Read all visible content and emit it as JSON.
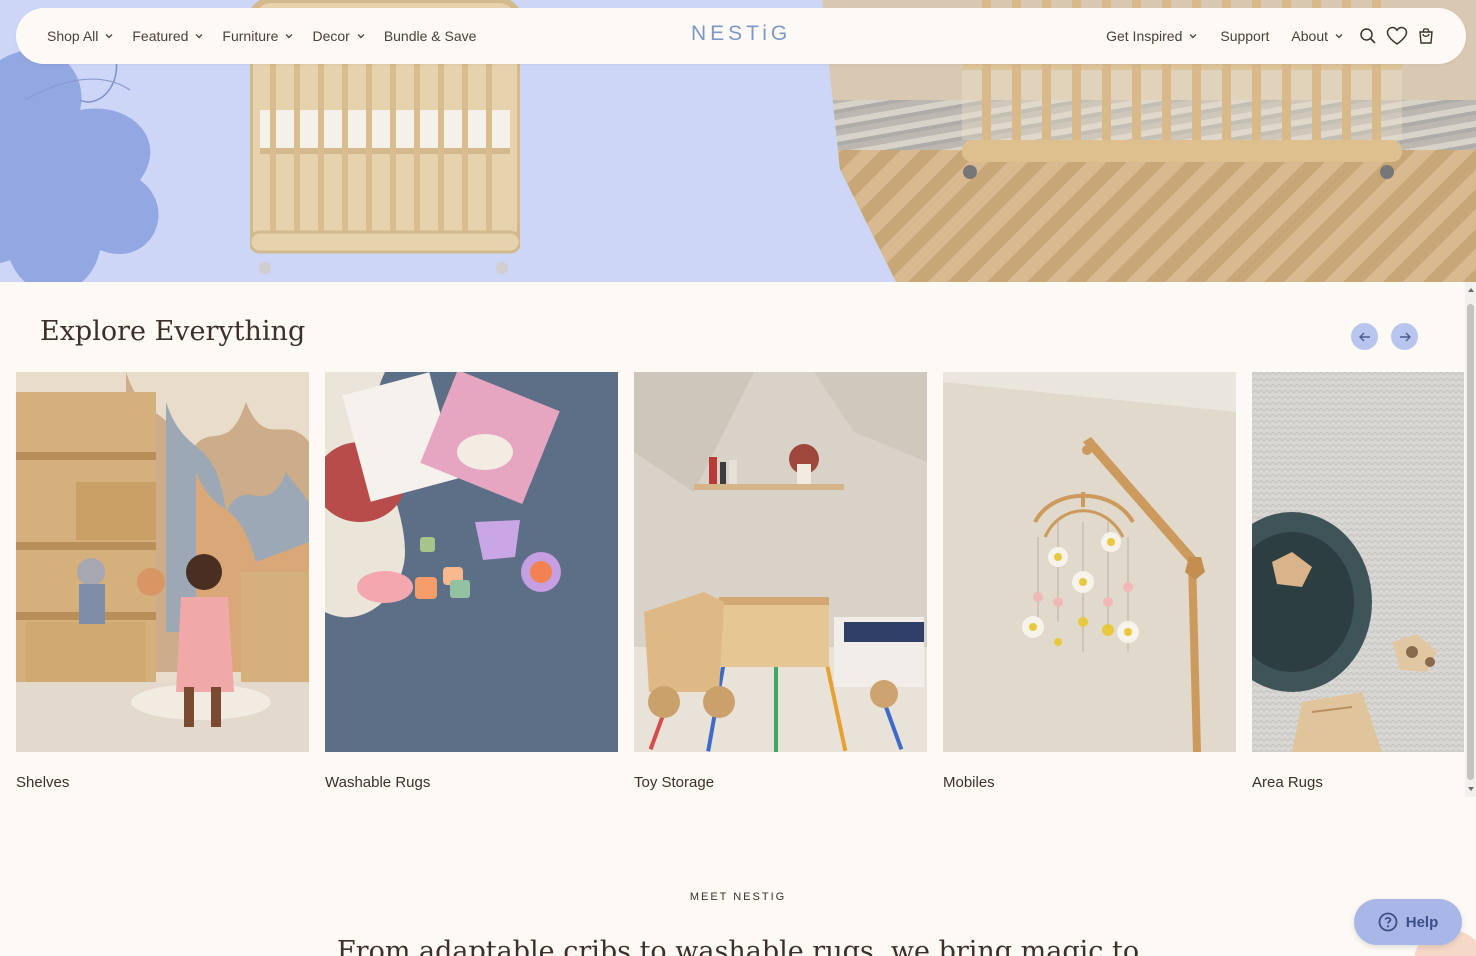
{
  "nav": {
    "left": [
      {
        "label": "Shop All",
        "dropdown": true
      },
      {
        "label": "Featured",
        "dropdown": true
      },
      {
        "label": "Furniture",
        "dropdown": true
      },
      {
        "label": "Decor",
        "dropdown": true
      },
      {
        "label": "Bundle & Save",
        "dropdown": false
      }
    ],
    "logo": "NESTiG",
    "right": [
      {
        "label": "Get Inspired",
        "dropdown": true
      },
      {
        "label": "Support",
        "dropdown": false
      },
      {
        "label": "About",
        "dropdown": true
      }
    ],
    "icons": [
      "search-icon",
      "heart-icon",
      "cart-icon"
    ]
  },
  "explore": {
    "title": "Explore Everything",
    "prev_icon": "arrow-left-icon",
    "next_icon": "arrow-right-icon",
    "cards": [
      {
        "label": "Shelves"
      },
      {
        "label": "Washable Rugs"
      },
      {
        "label": "Toy Storage"
      },
      {
        "label": "Mobiles"
      },
      {
        "label": "Area Rugs"
      }
    ]
  },
  "meet": {
    "eyebrow": "MEET NESTIG",
    "headline": "From adaptable cribs to washable rugs, we bring magic to"
  },
  "help": {
    "label": "Help",
    "icon": "question-circle-icon"
  },
  "colors": {
    "accent": "#b8c6ef",
    "logo": "#7d97c6",
    "background": "#fdf9f5",
    "help_bg": "#a9b7e8"
  }
}
